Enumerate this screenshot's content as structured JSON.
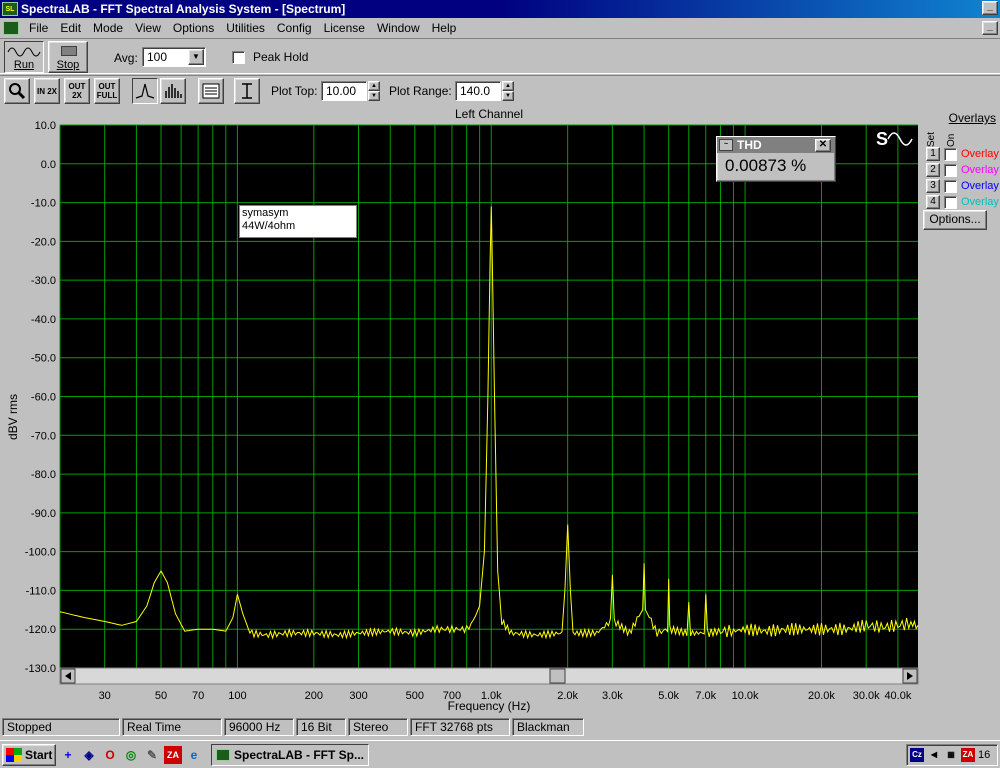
{
  "window": {
    "title": "SpectraLAB - FFT Spectral Analysis System - [Spectrum]"
  },
  "menu": {
    "items": [
      "File",
      "Edit",
      "Mode",
      "View",
      "Options",
      "Utilities",
      "Config",
      "License",
      "Window",
      "Help"
    ]
  },
  "toolbar": {
    "run_label": "Run",
    "stop_label": "Stop",
    "avg_label": "Avg:",
    "avg_value": "100",
    "peak_hold_label": "Peak Hold",
    "plot_top_label": "Plot Top:",
    "plot_top_value": "10.00",
    "plot_range_label": "Plot Range:",
    "plot_range_value": "140.0",
    "zoom_in_label": "IN 2X",
    "zoom_out_label": "OUT 2X",
    "zoom_full_label": "OUT FULL"
  },
  "thd": {
    "title": "THD",
    "value": "0.00873 %"
  },
  "annotation": {
    "line1": "symasym",
    "line2": "44W/4ohm"
  },
  "overlays": {
    "title": "Overlays",
    "col_set": "Set",
    "col_on": "On",
    "rows": [
      {
        "num": "1",
        "label": "Overlay",
        "color": "#ff0000"
      },
      {
        "num": "2",
        "label": "Overlay",
        "color": "#ff00ff"
      },
      {
        "num": "3",
        "label": "Overlay",
        "color": "#0000ff"
      },
      {
        "num": "4",
        "label": "Overlay",
        "color": "#00c0c0"
      }
    ],
    "options_label": "Options..."
  },
  "status": {
    "state": "Stopped",
    "mode": "Real Time",
    "rate": "96000 Hz",
    "bits": "16 Bit",
    "channels": "Stereo",
    "fft": "FFT 32768 pts",
    "window": "Blackman"
  },
  "taskbar": {
    "start_label": "Start",
    "task_label": "SpectraLAB - FFT Sp...",
    "tray_time": "16",
    "tray_lang": "Cz",
    "tray_za": "ZA"
  },
  "chart_data": {
    "type": "line",
    "title": "Left Channel",
    "xlabel": "Frequency (Hz)",
    "ylabel": "dBV rms",
    "xscale": "log",
    "xlim": [
      20,
      48000
    ],
    "ylim": [
      -130,
      10
    ],
    "grid": true,
    "background": "#000000",
    "grid_color": "#00a000",
    "line_color": "#ffff00",
    "ytick_labels": [
      "10.0",
      "0.0",
      "-10.0",
      "-20.0",
      "-30.0",
      "-40.0",
      "-50.0",
      "-60.0",
      "-70.0",
      "-80.0",
      "-90.0",
      "-100.0",
      "-110.0",
      "-120.0",
      "-130.0"
    ],
    "xtick_labels": [
      {
        "f": 30,
        "label": "30"
      },
      {
        "f": 50,
        "label": "50"
      },
      {
        "f": 70,
        "label": "70"
      },
      {
        "f": 100,
        "label": "100"
      },
      {
        "f": 200,
        "label": "200"
      },
      {
        "f": 300,
        "label": "300"
      },
      {
        "f": 500,
        "label": "500"
      },
      {
        "f": 700,
        "label": "700"
      },
      {
        "f": 1000,
        "label": "1.0k"
      },
      {
        "f": 2000,
        "label": "2.0k"
      },
      {
        "f": 3000,
        "label": "3.0k"
      },
      {
        "f": 5000,
        "label": "5.0k"
      },
      {
        "f": 7000,
        "label": "7.0k"
      },
      {
        "f": 10000,
        "label": "10.0k"
      },
      {
        "f": 20000,
        "label": "20.0k"
      },
      {
        "f": 30000,
        "label": "30.0k"
      },
      {
        "f": 40000,
        "label": "40.0k"
      }
    ],
    "series": [
      {
        "x": [
          20,
          25,
          30,
          35,
          40,
          44,
          47,
          50,
          53,
          57,
          62,
          70,
          80,
          90,
          96,
          100,
          105,
          112,
          130,
          160,
          200,
          250,
          300,
          400,
          500,
          600,
          700,
          800,
          850,
          900,
          940,
          970,
          990,
          1000,
          1010,
          1030,
          1060,
          1100,
          1200,
          1500,
          1900,
          1950,
          2000,
          2050,
          2100,
          2600,
          2950,
          3000,
          3050,
          3500,
          3950,
          4000,
          4050,
          4500,
          4950,
          5000,
          5050,
          5900,
          6000,
          6100,
          6900,
          7000,
          7100,
          8000,
          9000,
          10000,
          12000,
          15000,
          20000,
          25000,
          30000,
          35000,
          40000,
          45000,
          48000
        ],
        "y": [
          -115.5,
          -117,
          -118,
          -119,
          -118,
          -114,
          -108,
          -105,
          -108,
          -116,
          -120.5,
          -120,
          -120,
          -120.5,
          -117,
          -111,
          -116,
          -121,
          -121.5,
          -121,
          -121,
          -121.5,
          -121,
          -120.5,
          -121,
          -120,
          -120,
          -120,
          -118,
          -114,
          -100,
          -60,
          -25,
          -11,
          -25,
          -60,
          -105,
          -118,
          -121,
          -121.5,
          -121,
          -110,
          -93,
          -110,
          -121,
          -121,
          -118,
          -106,
          -118,
          -121,
          -115,
          -103,
          -115,
          -121,
          -120,
          -107,
          -120,
          -121,
          -113,
          -121,
          -121,
          -111,
          -121,
          -120.5,
          -120.5,
          -120,
          -120.5,
          -120,
          -120,
          -120,
          -119,
          -119.5,
          -119,
          -118.5,
          -119
        ]
      }
    ]
  }
}
